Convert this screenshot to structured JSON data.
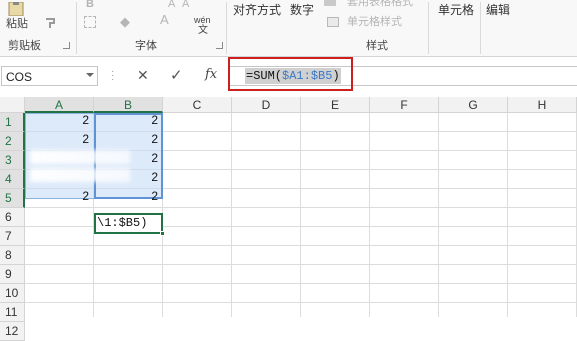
{
  "ribbon": {
    "groups": [
      {
        "label": "剪贴板"
      },
      {
        "label": "字体"
      },
      {
        "label": "对齐方式"
      },
      {
        "label": "数字"
      },
      {
        "label": "样式"
      },
      {
        "label": "单元格"
      },
      {
        "label": "编辑"
      }
    ],
    "clipboard_paste": "粘贴",
    "font_wen": "wén",
    "font_wen_char": "文",
    "style_table_format": "套用表格格式",
    "style_cell_style": "单元格样式",
    "font_bold_glyph": "B",
    "font_a_glyph": "A"
  },
  "formula_bar": {
    "name_box": "COS",
    "cancel_glyph": "✕",
    "enter_glyph": "✓",
    "fx_glyph": "fx",
    "formula_prefix": "=SUM(",
    "formula_ref": "$A1:$B5",
    "formula_suffix": ")"
  },
  "grid": {
    "columns": [
      "A",
      "B",
      "C",
      "D",
      "E",
      "F",
      "G",
      "H"
    ],
    "rows": [
      "1",
      "2",
      "3",
      "4",
      "5",
      "6",
      "7",
      "8",
      "9",
      "10",
      "11",
      "12"
    ],
    "values": {
      "A1": "2",
      "B1": "2",
      "A2": "2",
      "B2": "2",
      "B3": "2",
      "B4": "2",
      "A5": "2",
      "B5": "2"
    },
    "edit_cell_text": "\\1:$B5)"
  }
}
